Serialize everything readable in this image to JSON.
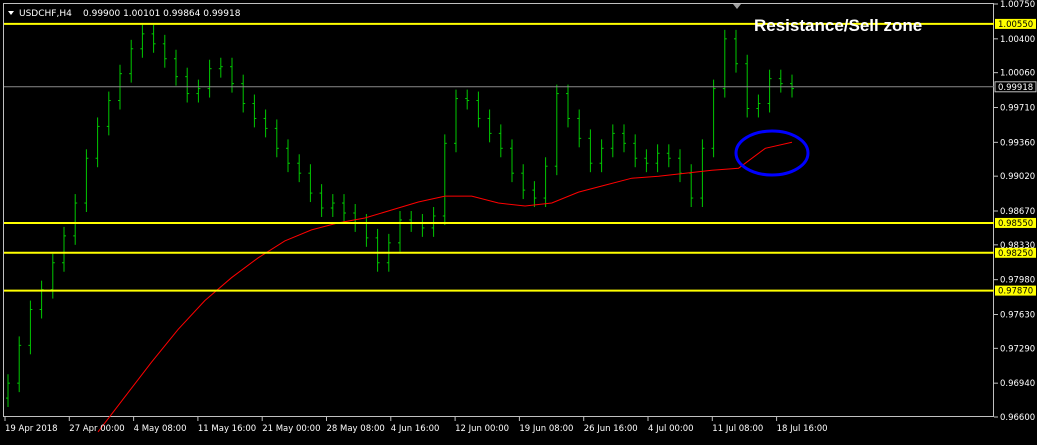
{
  "colors": {
    "background": "#000000",
    "candle": "#00c800",
    "ma": "#ff0000",
    "level": "#ffff00",
    "frame": "#c0c0c0",
    "circle": "#0000ff",
    "current_price_line": "#8a8a8a"
  },
  "header": {
    "symbol": "USDCHF,H4",
    "prices": "0.99900 1.00101 0.99864 0.99918"
  },
  "annotation": {
    "text": "Resistance/Sell zone"
  },
  "chart_data": {
    "type": "line",
    "title": "USDCHF,H4",
    "ylim": [
      0.966,
      1.0075
    ],
    "y_ticks": [
      "1.00750",
      "1.00400",
      "1.00060",
      "0.99710",
      "0.99360",
      "0.99020",
      "0.98670",
      "0.98330",
      "0.97980",
      "0.97630",
      "0.97290",
      "0.96940",
      "0.96600"
    ],
    "x_ticks": [
      "19 Apr 2018",
      "27 Apr 00:00",
      "4 May 08:00",
      "11 May 16:00",
      "21 May 00:00",
      "28 May 08:00",
      "4 Jun 16:00",
      "12 Jun 00:00",
      "19 Jun 08:00",
      "26 Jun 16:00",
      "4 Jul 00:00",
      "11 Jul 08:00",
      "18 Jul 16:00"
    ],
    "current_price": "0.99918",
    "levels": [
      {
        "value": "1.00550"
      },
      {
        "value": "0.98550"
      },
      {
        "value": "0.98250"
      },
      {
        "value": "0.97870"
      }
    ],
    "series": [
      {
        "type": "candles",
        "close": [
          0.9694,
          0.9732,
          0.9768,
          0.9788,
          0.9815,
          0.9842,
          0.9875,
          0.992,
          0.9952,
          0.9978,
          1.0005,
          1.003,
          1.0045,
          1.0035,
          1.002,
          1.0002,
          0.9985,
          0.999,
          1.001,
          1.0012,
          0.9995,
          0.9975,
          0.996,
          0.995,
          0.993,
          0.9915,
          0.9905,
          0.9885,
          0.987,
          0.9875,
          0.9865,
          0.9855,
          0.984,
          0.9815,
          0.9835,
          0.9858,
          0.9855,
          0.985,
          0.9862,
          0.9935,
          0.998,
          0.9978,
          0.996,
          0.9945,
          0.993,
          0.9905,
          0.9888,
          0.988,
          0.9912,
          0.9985,
          0.996,
          0.994,
          0.9915,
          0.993,
          0.9945,
          0.9935,
          0.992,
          0.9915,
          0.9925,
          0.992,
          0.9905,
          0.988,
          0.993,
          0.999,
          1.004,
          1.0015,
          0.997,
          0.9975,
          1.0,
          0.9995,
          0.999
        ]
      },
      {
        "type": "ma",
        "values": [
          0.9645,
          0.968,
          0.9715,
          0.9748,
          0.9777,
          0.98,
          0.982,
          0.9837,
          0.9848,
          0.9855,
          0.986,
          0.9868,
          0.9876,
          0.9882,
          0.9882,
          0.9875,
          0.9872,
          0.9875,
          0.9886,
          0.9893,
          0.99,
          0.9902,
          0.9905,
          0.9908,
          0.991,
          0.993,
          0.9936
        ]
      }
    ]
  }
}
